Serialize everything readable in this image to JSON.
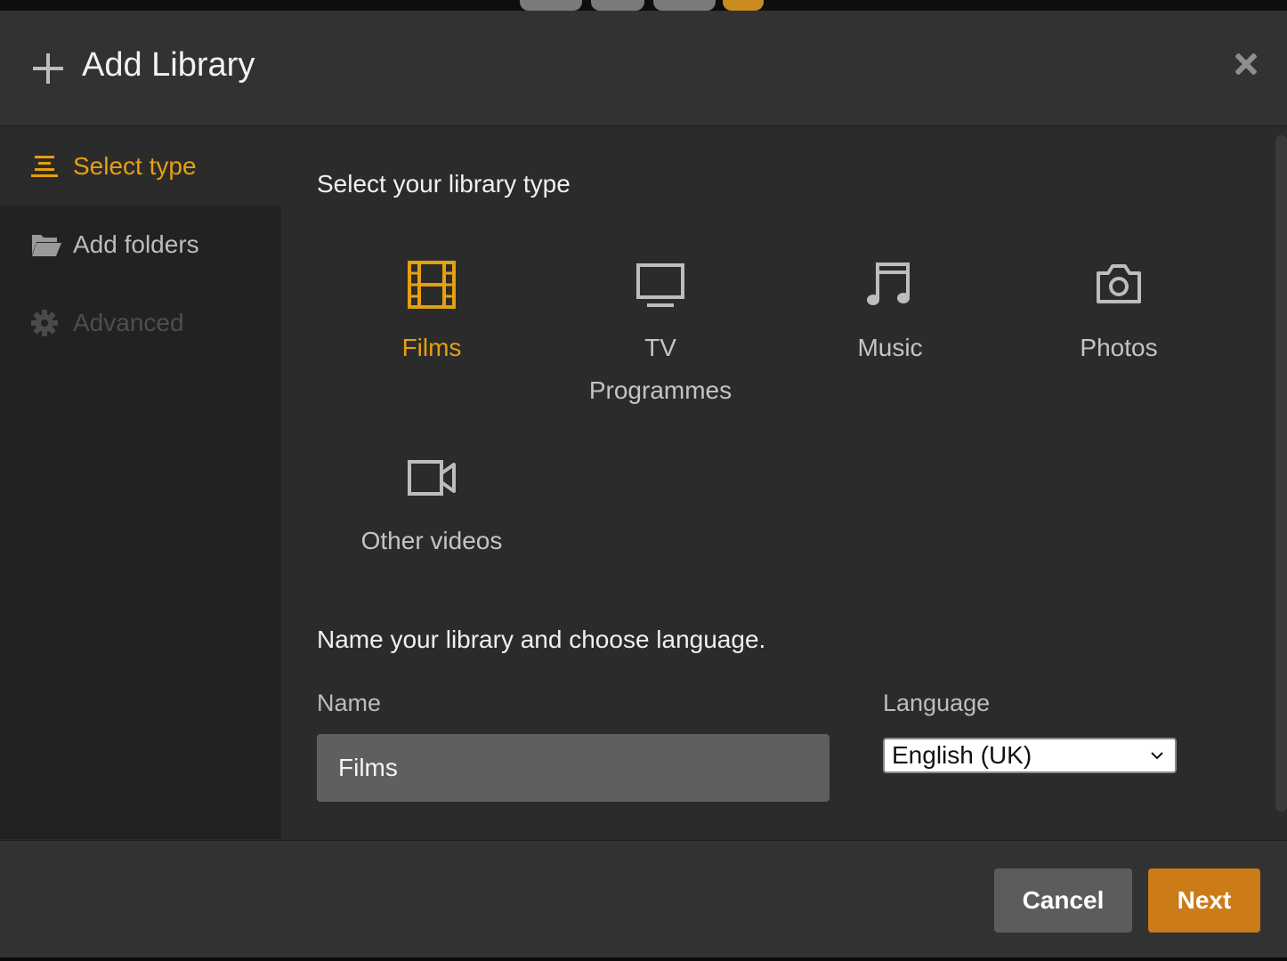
{
  "dialog": {
    "title": "Add Library",
    "add_icon": "plus-icon",
    "close_icon": "close-icon"
  },
  "sidebar": {
    "items": [
      {
        "label": "Select type",
        "icon": "list-icon",
        "state": "active"
      },
      {
        "label": "Add folders",
        "icon": "folder-icon",
        "state": "normal"
      },
      {
        "label": "Advanced",
        "icon": "gear-icon",
        "state": "disabled"
      }
    ]
  },
  "main": {
    "type_heading": "Select your library type",
    "types": [
      {
        "label": "Films",
        "icon": "film-icon",
        "selected": true
      },
      {
        "label": "TV\nProgrammes",
        "icon": "tv-icon",
        "selected": false
      },
      {
        "label": "Music",
        "icon": "music-note-icon",
        "selected": false
      },
      {
        "label": "Photos",
        "icon": "camera-icon",
        "selected": false
      },
      {
        "label": "Other videos",
        "icon": "video-camera-icon",
        "selected": false
      }
    ],
    "name_heading": "Name your library and choose language.",
    "name_label": "Name",
    "name_value": "Films",
    "language_label": "Language",
    "language_value": "English (UK)"
  },
  "footer": {
    "cancel_label": "Cancel",
    "next_label": "Next"
  },
  "colors": {
    "accent": "#e5a00d",
    "next_button": "#cc7b19",
    "cancel_button": "#5c5c5c",
    "background": "#2b2b2b",
    "sidebar": "#222222"
  }
}
